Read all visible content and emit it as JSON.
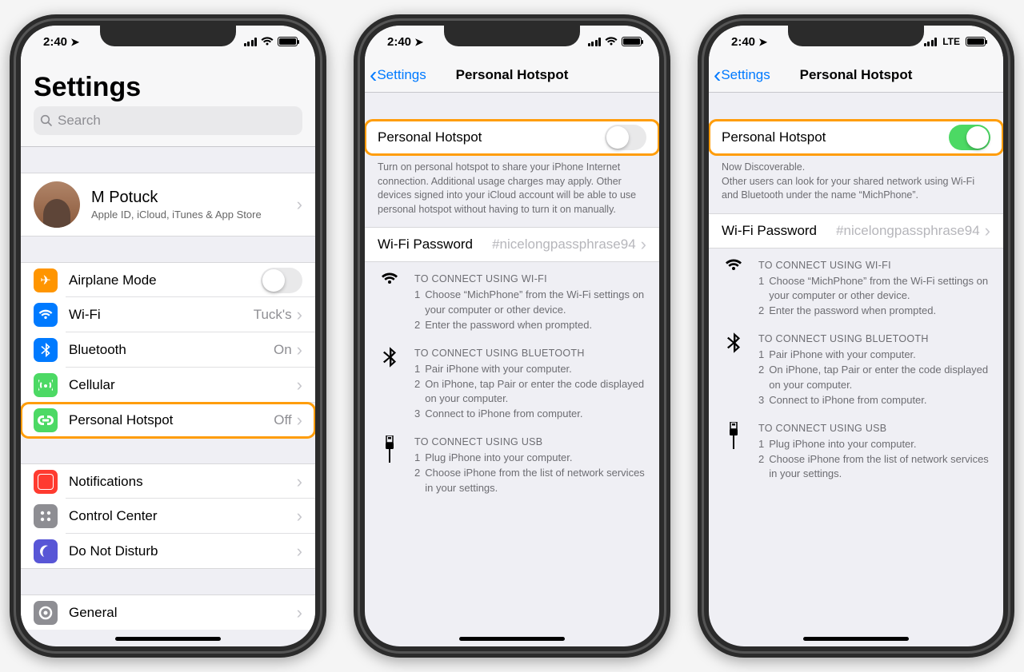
{
  "status": {
    "time": "2:40",
    "lte": "LTE"
  },
  "p1": {
    "title": "Settings",
    "search_placeholder": "Search",
    "profile": {
      "name": "M Potuck",
      "sub": "Apple ID, iCloud, iTunes & App Store"
    },
    "airplane": "Airplane Mode",
    "wifi": "Wi-Fi",
    "wifi_val": "Tuck's",
    "bt": "Bluetooth",
    "bt_val": "On",
    "cell": "Cellular",
    "ph": "Personal Hotspot",
    "ph_val": "Off",
    "notif": "Notifications",
    "cc": "Control Center",
    "dnd": "Do Not Disturb",
    "gen": "General"
  },
  "p2": {
    "back": "Settings",
    "title": "Personal Hotspot",
    "row_label": "Personal Hotspot",
    "desc": "Turn on personal hotspot to share your iPhone Internet connection. Additional usage charges may apply. Other devices signed into your iCloud account will be able to use personal hotspot without having to turn it on manually.",
    "wifi_pw_label": "Wi-Fi Password",
    "wifi_pw_value": "#nicelongpassphrase94",
    "wifi_hd": "TO CONNECT USING WI-FI",
    "wifi_1": "Choose “MichPhone” from the Wi-Fi settings on your computer or other device.",
    "wifi_2": "Enter the password when prompted.",
    "bt_hd": "TO CONNECT USING BLUETOOTH",
    "bt_1": "Pair iPhone with your computer.",
    "bt_2": "On iPhone, tap Pair or enter the code displayed on your computer.",
    "bt_3": "Connect to iPhone from computer.",
    "usb_hd": "TO CONNECT USING USB",
    "usb_1": "Plug iPhone into your computer.",
    "usb_2": "Choose iPhone from the list of network services in your settings."
  },
  "p3": {
    "back": "Settings",
    "title": "Personal Hotspot",
    "row_label": "Personal Hotspot",
    "desc1": "Now Discoverable.",
    "desc2": "Other users can look for your shared network using Wi-Fi and Bluetooth under the name “MichPhone”.",
    "wifi_pw_label": "Wi-Fi Password",
    "wifi_pw_value": "#nicelongpassphrase94"
  }
}
